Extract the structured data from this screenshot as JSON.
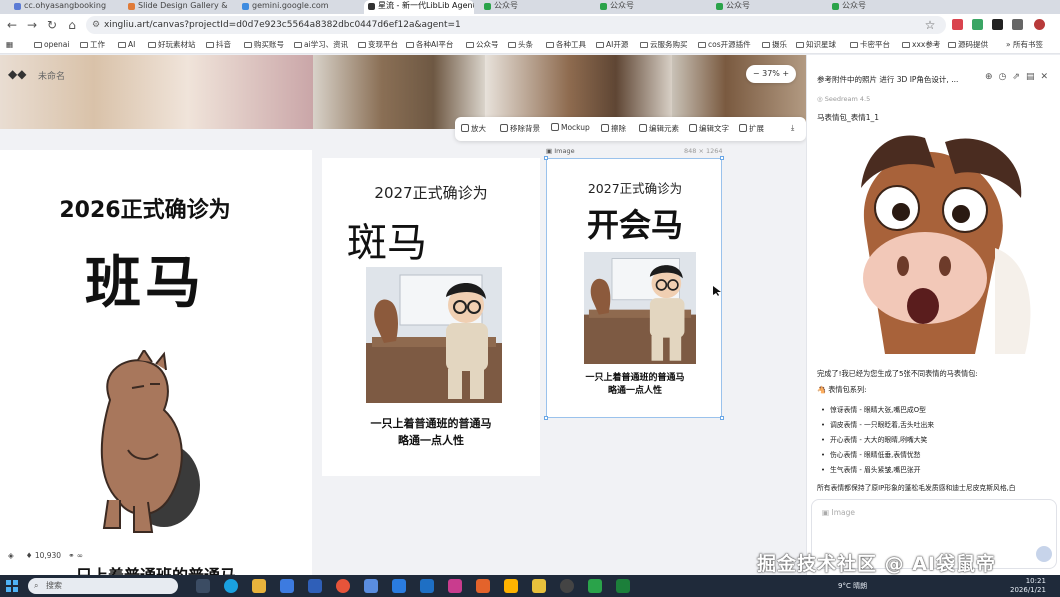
{
  "browser": {
    "tabs": [
      {
        "title": "cc.ohyasangbooking",
        "color": "#5b7bd5"
      },
      {
        "title": "Slide Design Gallery &",
        "color": "#e07b39"
      },
      {
        "title": "gemini.google.com",
        "color": "#3d8be0"
      },
      {
        "title": "星流 - 新一代LibLib Agent",
        "color": "#333333",
        "active": true
      },
      {
        "title": "公众号",
        "color": "#2aa34a"
      },
      {
        "title": "公众号",
        "color": "#2aa34a"
      },
      {
        "title": "公众号",
        "color": "#2aa34a"
      },
      {
        "title": "公众号",
        "color": "#2aa34a"
      }
    ],
    "url": "xingliu.art/canvas?projectId=d0d7e923c5564a8382dbc0447d6ef12a&agent=1",
    "bookmarks": [
      "openai",
      "工作",
      "AI",
      "好玩素材站",
      "抖音",
      "购买账号",
      "ai学习、资讯",
      "变现平台",
      "各种AI平台",
      "公众号",
      "头条",
      "各种工具",
      "AI开源",
      "云服务购买",
      "cos开源插件",
      "摄乐",
      "知识星球",
      "卡密平台",
      "xxx参考",
      "源码提供"
    ],
    "more_bookmarks": "所有书签"
  },
  "canvas": {
    "project_name": "未命名",
    "zoom": "37%",
    "image_toolbar": [
      "放大",
      "移除背景",
      "Mockup",
      "擦除",
      "编辑元素",
      "编辑文字",
      "扩展"
    ],
    "left_tools": [
      "select-icon",
      "add-icon",
      "frame-icon",
      "text-icon",
      "pen-icon",
      "image-icon",
      "upload-icon"
    ],
    "selected_label": "Image",
    "selected_size": "848 × 1264",
    "card1": {
      "title": "2026正式确诊为",
      "big": "班马",
      "bottom": "只上着普通班的普通马"
    },
    "card2": {
      "title": "2027正式确诊为",
      "big": "斑马",
      "caption_line1": "一只上着普通班的普通马",
      "caption_line2": "略通一点人性"
    },
    "card3": {
      "title": "2027正式确诊为",
      "big": "开会马",
      "caption_line1": "一只上着普通班的普通马",
      "caption_line2": "略通一点人性"
    },
    "credits": "10,930",
    "credits_extra": "∞"
  },
  "panel": {
    "title": "参考附件中的照片 进行 3D IP角色设计, ...",
    "model": "Seedream 4.5",
    "heading": "马表情包_表情1_1",
    "message": "完成了!我已经为您生成了5张不同表情的马表情包:",
    "section": "🐴 表情包系列:",
    "items": [
      "惊讶表情 - 眼睛大张,嘴巴成O型",
      "调皮表情 - 一只眼眨着,舌头吐出来",
      "开心表情 - 大大的眼睛,咧嘴大笑",
      "伤心表情 - 眼睛低垂,表情忧愁",
      "生气表情 - 眉头紧皱,嘴巴张开"
    ],
    "footer": "所有表情都保持了原IP形象的蓬松毛发质感和迪士尼皮克斯风格,白",
    "input_placeholder": "Image"
  },
  "taskbar": {
    "search": "搜索",
    "weather": "9°C 晴朗",
    "time": "10:21",
    "date": "2026/1/21"
  },
  "watermark": "掘金技术社区 @ AI袋鼠帝"
}
